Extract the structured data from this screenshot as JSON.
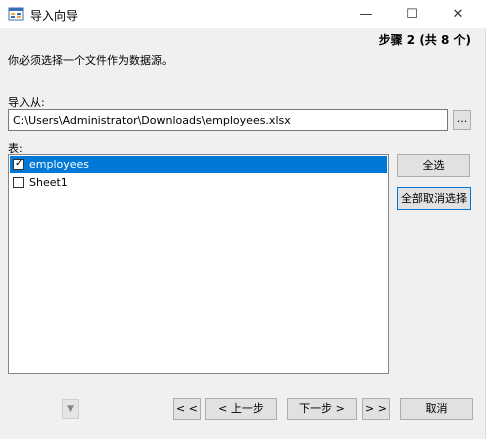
{
  "window": {
    "title": "导入向导",
    "minimize_glyph": "—",
    "maximize_glyph": "☐",
    "close_glyph": "✕"
  },
  "header": {
    "step": "步骤 2 (共 8 个)",
    "description": "你必须选择一个文件作为数据源。"
  },
  "source": {
    "label": "导入从:",
    "path": "C:\\Users\\Administrator\\Downloads\\employees.xlsx",
    "browse_label": "..."
  },
  "tables": {
    "label": "表:",
    "items": [
      {
        "name": "employees",
        "checked": true,
        "selected": true
      },
      {
        "name": "Sheet1",
        "checked": false,
        "selected": false
      }
    ],
    "select_all_label": "全选",
    "deselect_all_label": "全部取消选择"
  },
  "footer": {
    "first_label": "< <",
    "prev_label": "< 上一步",
    "next_label": "下一步 >",
    "last_label": "> >",
    "cancel_label": "取消"
  },
  "colors": {
    "selection": "#0078d7",
    "window_bg": "#f0f0f0"
  }
}
